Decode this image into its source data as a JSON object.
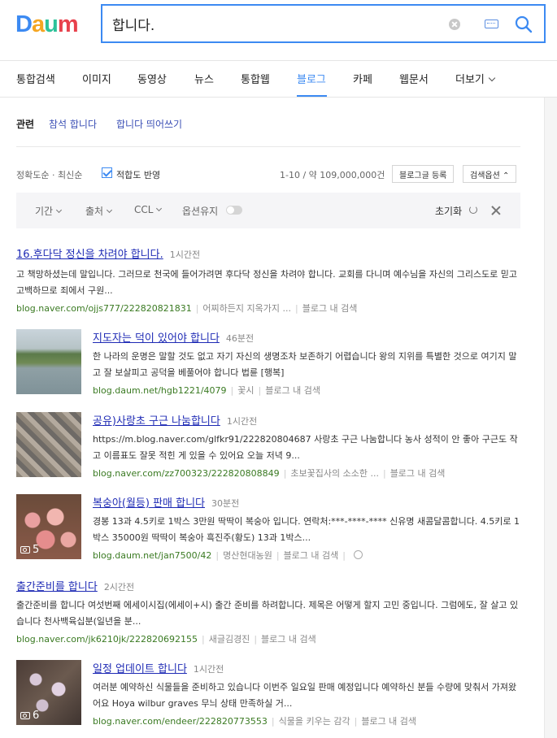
{
  "logo": {
    "text": "Daum"
  },
  "search": {
    "query": "합니다.",
    "placeholder": ""
  },
  "tabs": [
    {
      "label": "통합검색"
    },
    {
      "label": "이미지"
    },
    {
      "label": "동영상"
    },
    {
      "label": "뉴스"
    },
    {
      "label": "통합웹"
    },
    {
      "label": "블로그",
      "active": true
    },
    {
      "label": "카페"
    },
    {
      "label": "웹문서"
    },
    {
      "label": "더보기"
    }
  ],
  "related": {
    "title": "관련",
    "links": [
      "참석 합니다",
      "합니다 띄어쓰기"
    ]
  },
  "sort": {
    "options": "정확도순 · 최신순",
    "checkbox_label": "적합도 반영",
    "count": "1-10 / 약 109,000,000건",
    "register_btn": "블로그글 등록",
    "options_btn": "검색옵션 ⌃"
  },
  "filters": {
    "period": "기간",
    "source": "출처",
    "ccl": "CCL",
    "keep_options": "옵션유지",
    "reset": "초기화"
  },
  "results": [
    {
      "title": "16.후다닥 정신을 차려야 합니다.",
      "time": "1시간전",
      "desc": "고 책망하셨는데 말입니다. 그러므로 천국에 들어가려면 후다닥 정신을 차려야 합니다. 교회를 다니며 예수님을 자신의 그리스도로 믿고 고백하므로 죄에서 구원...",
      "url": "blog.naver.com/ojjs777/222820821831",
      "blog": "어찌하든지 지옥가지 ...",
      "inner": "블로그 내 검색"
    },
    {
      "title": "지도자는 덕이 있어야 합니다",
      "time": "46분전",
      "desc": "한 나라의 운명은 말할 것도 없고 자기 자신의 생명조차 보존하기 어렵습니다 왕의 지위를 특별한 것으로 여기지 말고 잘 보살피고 공덕을 베풀어야 합니다 법륜 [행복]",
      "url": "blog.daum.net/hgb1221/4079",
      "blog": "꽃시",
      "inner": "블로그 내 검색"
    },
    {
      "title": "공유)사랑초 구근 나눔합니다",
      "time": "1시간전",
      "desc": "https://m.blog.naver.com/glfkr91/222820804687 사랑초 구근 나눔합니다 농사 성적이 안 좋아 구근도 작고 이름표도 잘못 적힌 게 있을 수 있어요 오늘 저녁 9...",
      "url": "blog.naver.com/zz700323/222820808849",
      "blog": "초보꽃집사의 소소한 ...",
      "inner": "블로그 내 검색"
    },
    {
      "title": "복숭아(월등) 판매 합니다",
      "time": "30분전",
      "desc": "경봉 13과 4.5키로 1박스 3만원 딱딱이 복숭아 입니다. 연락처:***-****-**** 신유명 새콤달콤합니다. 4.5키로 1박스 35000원 딱딱이 복숭아 흑진주(황도) 13과 1박스...",
      "url": "blog.daum.net/jan7500/42",
      "blog": "명산현대농원",
      "inner": "블로그 내 검색",
      "photos": "5"
    },
    {
      "title": "출간준비를 합니다",
      "time": "2시간전",
      "desc": "출간준비를 합니다 여섯번째 에세이시집(에세이+시) 출간 준비를 하려합니다. 제목은 어떻게 할지 고민 중입니다. 그럼에도, 잘 살고 있습니다 천사백육십분(일년을 분...",
      "url": "blog.naver.com/jk6210jk/222820692155",
      "blog": "새글김경진",
      "inner": "블로그 내 검색"
    },
    {
      "title": "일정 업데이트 합니다",
      "time": "1시간전",
      "desc": "여러분 예약하신 식물들을 준비하고 있습니다 이번주 일요일 판매 예정입니다 예약하신 분들 수량에 맞춰서 가져왔어요 Hoya wilbur graves 무늬 상태 만족하실 거...",
      "url": "blog.naver.com/endeer/222820773553",
      "blog": "식물을 키우는 감각",
      "inner": "블로그 내 검색",
      "photos": "6"
    }
  ],
  "colors": {
    "accent": "#3c8af2",
    "link": "#1f2bb5",
    "url_green": "#3a7a22"
  }
}
